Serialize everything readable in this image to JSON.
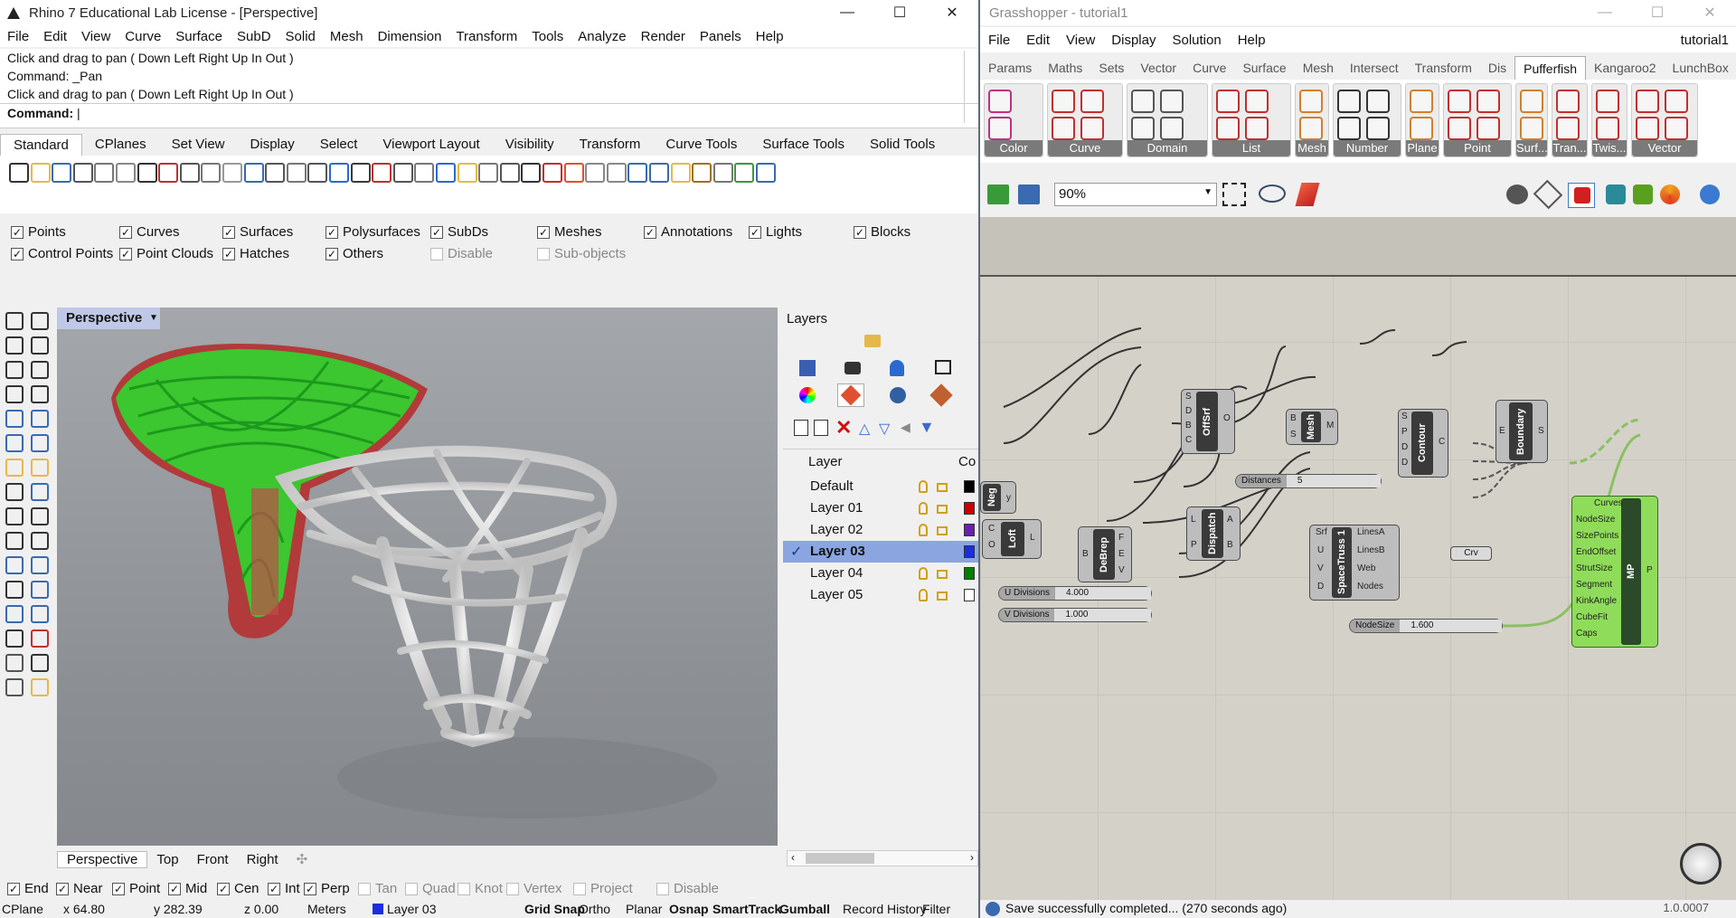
{
  "rhino": {
    "title": "Rhino 7 Educational Lab License - [Perspective]",
    "menu": [
      "File",
      "Edit",
      "View",
      "Curve",
      "Surface",
      "SubD",
      "Solid",
      "Mesh",
      "Dimension",
      "Transform",
      "Tools",
      "Analyze",
      "Render",
      "Panels",
      "Help"
    ],
    "history": [
      "Click and drag to pan ( Down  Left  Right  Up  In  Out )",
      "Command: _Pan",
      "Click and drag to pan ( Down  Left  Right  Up  In  Out )"
    ],
    "command_label": "Command:",
    "tabs": [
      "Standard",
      "CPlanes",
      "Set View",
      "Display",
      "Select",
      "Viewport Layout",
      "Visibility",
      "Transform",
      "Curve Tools",
      "Surface Tools",
      "Solid Tools"
    ],
    "filters_row1": [
      {
        "label": "Points",
        "checked": true
      },
      {
        "label": "Curves",
        "checked": true
      },
      {
        "label": "Surfaces",
        "checked": true
      },
      {
        "label": "Polysurfaces",
        "checked": true
      },
      {
        "label": "SubDs",
        "checked": true
      },
      {
        "label": "Meshes",
        "checked": true
      },
      {
        "label": "Annotations",
        "checked": true
      },
      {
        "label": "Lights",
        "checked": true
      },
      {
        "label": "Blocks",
        "checked": true
      }
    ],
    "filters_row2": [
      {
        "label": "Control Points",
        "checked": true
      },
      {
        "label": "Point Clouds",
        "checked": true
      },
      {
        "label": "Hatches",
        "checked": true
      },
      {
        "label": "Others",
        "checked": true
      },
      {
        "label": "Disable",
        "checked": false
      },
      {
        "label": "Sub-objects",
        "checked": false
      }
    ],
    "viewport_label": "Perspective",
    "viewport_tabs": [
      "Perspective",
      "Top",
      "Front",
      "Right"
    ],
    "layers_title": "Layers",
    "layers_header": "Layer",
    "layers_col_color": "Co",
    "layers": [
      {
        "name": "Default",
        "color": "#000000"
      },
      {
        "name": "Layer 01",
        "color": "#cc0000"
      },
      {
        "name": "Layer 02",
        "color": "#6a1fb0"
      },
      {
        "name": "Layer 03",
        "color": "#1a2ee0"
      },
      {
        "name": "Layer 04",
        "color": "#008000"
      },
      {
        "name": "Layer 05",
        "color": "#ffffff"
      }
    ],
    "current_layer": "Layer 03",
    "osnaps": [
      {
        "label": "End",
        "checked": true
      },
      {
        "label": "Near",
        "checked": true
      },
      {
        "label": "Point",
        "checked": true
      },
      {
        "label": "Mid",
        "checked": true
      },
      {
        "label": "Cen",
        "checked": true
      },
      {
        "label": "Int",
        "checked": true
      },
      {
        "label": "Perp",
        "checked": true
      },
      {
        "label": "Tan",
        "checked": false
      },
      {
        "label": "Quad",
        "checked": false
      },
      {
        "label": "Knot",
        "checked": false
      },
      {
        "label": "Vertex",
        "checked": false
      },
      {
        "label": "Project",
        "checked": false
      },
      {
        "label": "Disable",
        "checked": false
      }
    ],
    "status": {
      "cplane": "CPlane",
      "x": "x 64.80",
      "y": "y 282.39",
      "z": "z 0.00",
      "units": "Meters",
      "layer": "Layer 03",
      "toggles": [
        "Grid Snap",
        "Ortho",
        "Planar",
        "Osnap",
        "SmartTrack",
        "Gumball",
        "Record History",
        "Filter"
      ]
    }
  },
  "gh": {
    "title": "Grasshopper - tutorial1",
    "menu": [
      "File",
      "Edit",
      "View",
      "Display",
      "Solution",
      "Help"
    ],
    "doc_name": "tutorial1",
    "tabs": [
      "Params",
      "Maths",
      "Sets",
      "Vector",
      "Curve",
      "Surface",
      "Mesh",
      "Intersect",
      "Transform",
      "Dis",
      "Pufferfish",
      "Kangaroo2",
      "LunchBox"
    ],
    "active_tab": "Pufferfish",
    "groups": [
      "Color",
      "Curve",
      "Domain",
      "List",
      "Mesh",
      "Number",
      "Plane",
      "Point",
      "Surf...",
      "Tran...",
      "Twis...",
      "Vector"
    ],
    "zoom": "90%",
    "nodes": {
      "offsrf": {
        "name": "OffSrf",
        "inputs": [
          "S",
          "D",
          "B",
          "C"
        ],
        "outputs": [
          "O"
        ]
      },
      "mesh": {
        "name": "Mesh",
        "inputs": [
          "B",
          "S"
        ],
        "outputs": [
          "M"
        ]
      },
      "contour": {
        "name": "Contour",
        "inputs": [
          "S",
          "P",
          "D",
          "D"
        ],
        "outputs": [
          "C"
        ]
      },
      "boundary": {
        "name": "Boundary",
        "inputs": [
          "E"
        ],
        "outputs": [
          "S"
        ]
      },
      "neg": {
        "name": "Neg",
        "outputs": [
          "y"
        ]
      },
      "loft": {
        "name": "Loft",
        "inputs": [
          "C",
          "O"
        ],
        "outputs": [
          "L"
        ]
      },
      "debrep": {
        "name": "DeBrep",
        "inputs": [
          "B"
        ],
        "outputs": [
          "F",
          "E",
          "V"
        ]
      },
      "dispatch": {
        "name": "Dispatch",
        "inputs": [
          "L",
          "P"
        ],
        "outputs": [
          "A",
          "B"
        ]
      },
      "spacetruss": {
        "name": "SpaceTruss 1",
        "inputs": [
          "Srf",
          "U",
          "V",
          "D"
        ],
        "outputs": [
          "LinesA",
          "LinesB",
          "Web",
          "Nodes"
        ]
      },
      "crv": {
        "name": "Crv"
      },
      "mp": {
        "name": "MP",
        "inputs": [
          "Curves",
          "NodeSize",
          "SizePoints",
          "EndOffset",
          "StrutSize",
          "Segment",
          "KinkAngle",
          "CubeFit",
          "Caps"
        ],
        "outputs": [
          "P"
        ]
      }
    },
    "sliders": [
      {
        "name": "Distances",
        "value": "5"
      },
      {
        "name": "U Divisions",
        "value": "4.000"
      },
      {
        "name": "V Divisions",
        "value": "1.000"
      },
      {
        "name": "NodeSize",
        "value": "1.600"
      }
    ],
    "status": "Save successfully completed... (270 seconds ago)",
    "version": "1.0.0007"
  }
}
